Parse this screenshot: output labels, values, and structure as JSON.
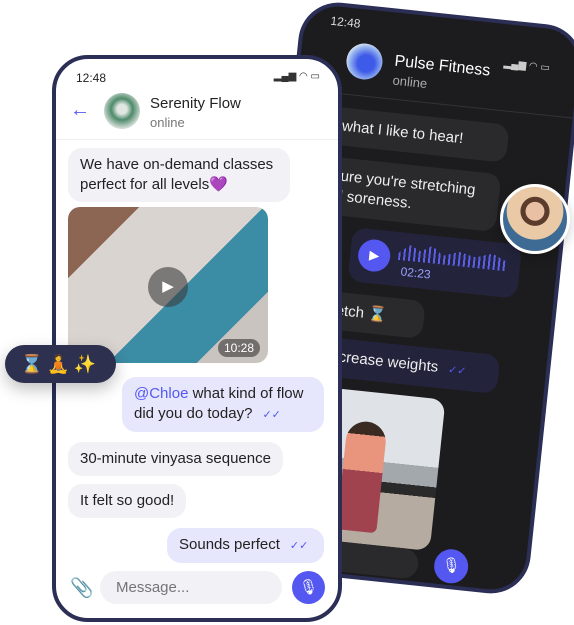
{
  "back_phone": {
    "time": "12:48",
    "contact_name": "Pulse Fitness",
    "contact_status": "online",
    "messages": [
      {
        "text": "That's what I like to hear!"
      },
      {
        "text": "Make sure you're stretching to avoid soreness."
      },
      {
        "audio_duration": "02:23"
      },
      {
        "text": "Quad stretch ⌛"
      },
      {
        "text": "Time to increase weights",
        "ticks": "✓✓"
      }
    ]
  },
  "front_phone": {
    "time": "12:48",
    "contact_name": "Serenity Flow",
    "contact_status": "online",
    "messages": [
      {
        "text": "We have on-demand classes perfect for all levels💜"
      },
      {
        "video_duration": "10:28"
      },
      {
        "mention": "@Chloe",
        "text": " what kind of flow did you do today?",
        "ticks": "✓✓"
      },
      {
        "text": "30-minute vinyasa sequence"
      },
      {
        "text": "It felt so good!"
      },
      {
        "text": "Sounds perfect",
        "ticks": "✓✓"
      }
    ],
    "input_placeholder": "Message..."
  },
  "reactions": "⌛🧘✨",
  "colors": {
    "accent": "#5458f0",
    "frame": "#2b2e55",
    "dark_bg": "#1c1c1f"
  }
}
